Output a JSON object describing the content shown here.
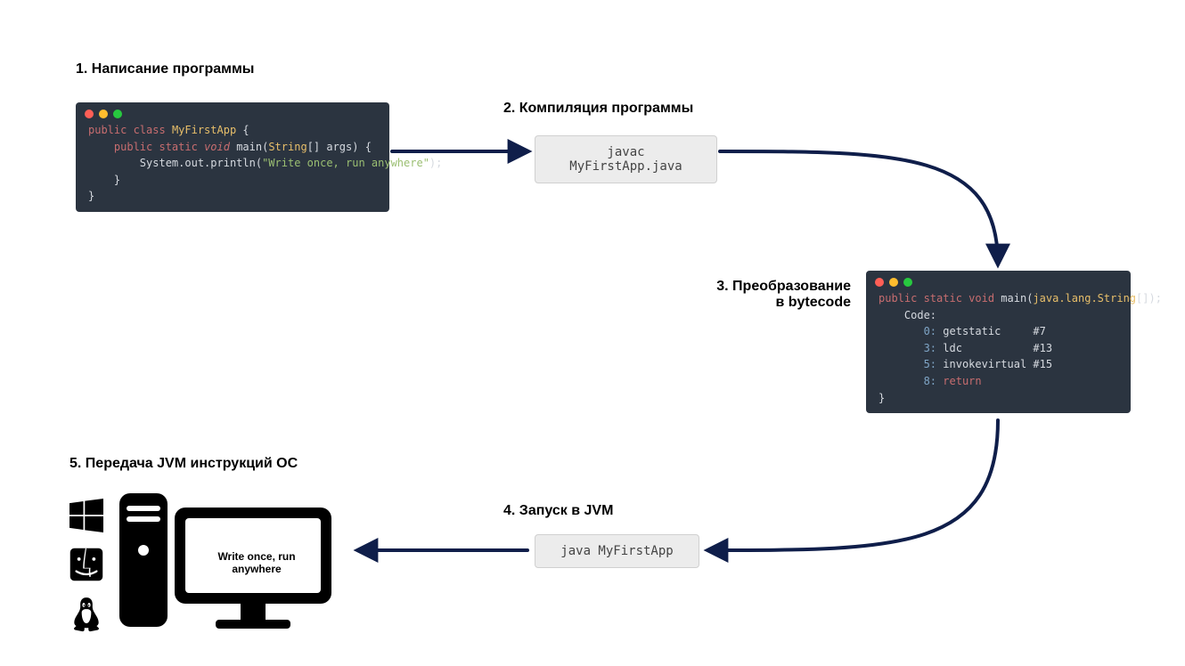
{
  "step1": {
    "title": "1. Написание программы"
  },
  "step2": {
    "title": "2. Компиляция программы",
    "command": "javac MyFirstApp.java"
  },
  "step3": {
    "title": "3. Преобразование\nв bytecode"
  },
  "step4": {
    "title": "4. Запуск в JVM",
    "command": "java MyFirstApp"
  },
  "step5": {
    "title": "5. Передача JVM инструкций ОС"
  },
  "source_code": {
    "class_name": "MyFirstApp",
    "print_literal": "\"Write once, run anywhere\""
  },
  "bytecode": {
    "signature_head": "public static void",
    "signature_method": "main",
    "signature_param": "java.lang.String",
    "code_label": "Code:",
    "instructions": [
      {
        "off": "0:",
        "op": "getstatic",
        "arg": "#7"
      },
      {
        "off": "3:",
        "op": "ldc",
        "arg": "#13"
      },
      {
        "off": "5:",
        "op": "invokevirtual",
        "arg": "#15"
      },
      {
        "off": "8:",
        "op": "return",
        "arg": ""
      }
    ]
  },
  "output_text": "Write once, run anywhere",
  "os_list": [
    "windows",
    "macos",
    "linux"
  ],
  "arrow_color": "#0f1e4a"
}
